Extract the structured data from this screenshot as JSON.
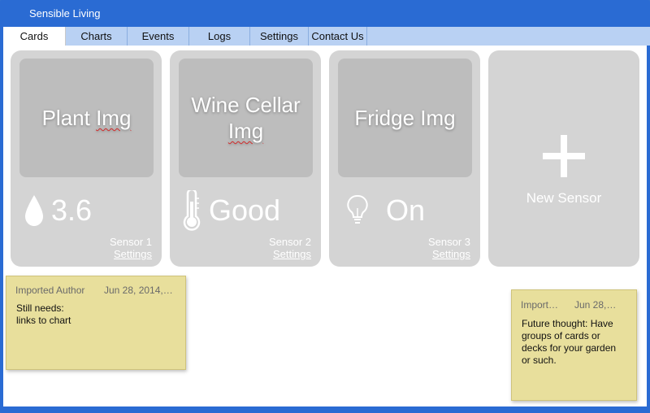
{
  "app": {
    "title": "Sensible Living"
  },
  "tabs": [
    {
      "label": "Cards",
      "active": true
    },
    {
      "label": "Charts",
      "active": false
    },
    {
      "label": "Events",
      "active": false
    },
    {
      "label": "Logs",
      "active": false
    },
    {
      "label": "Settings",
      "active": false
    },
    {
      "label": "Contact Us",
      "active": false
    }
  ],
  "cards": [
    {
      "image_label_a": "Plant ",
      "image_label_b": "Img",
      "icon": "water-drop-icon",
      "value": "3.6",
      "sensor": "Sensor 1",
      "settings_label": "Settings"
    },
    {
      "image_label_a": "Wine Cellar",
      "image_label_b": "Img",
      "icon": "thermometer-icon",
      "value": "Good",
      "sensor": "Sensor 2",
      "settings_label": "Settings"
    },
    {
      "image_label_a": "Fridge Img",
      "image_label_b": "",
      "icon": "light-bulb-icon",
      "value": "On",
      "sensor": "Sensor 3",
      "settings_label": "Settings"
    }
  ],
  "new_sensor": {
    "label": "New Sensor",
    "icon": "plus-icon"
  },
  "notes": [
    {
      "author": "Imported Author",
      "date": "Jun 28, 2014,…",
      "body": "Still needs:\nlinks to chart"
    },
    {
      "author": "Import…",
      "date": "Jun 28,…",
      "body": "Future thought: Have\ngroups of cards or\ndecks for your garden\nor such."
    }
  ],
  "colors": {
    "frame": "#2a6bd3",
    "tabbar": "#b9d1f3",
    "card": "#d4d4d4",
    "card_image": "#bdbdbd",
    "note": "#e8df9c"
  }
}
